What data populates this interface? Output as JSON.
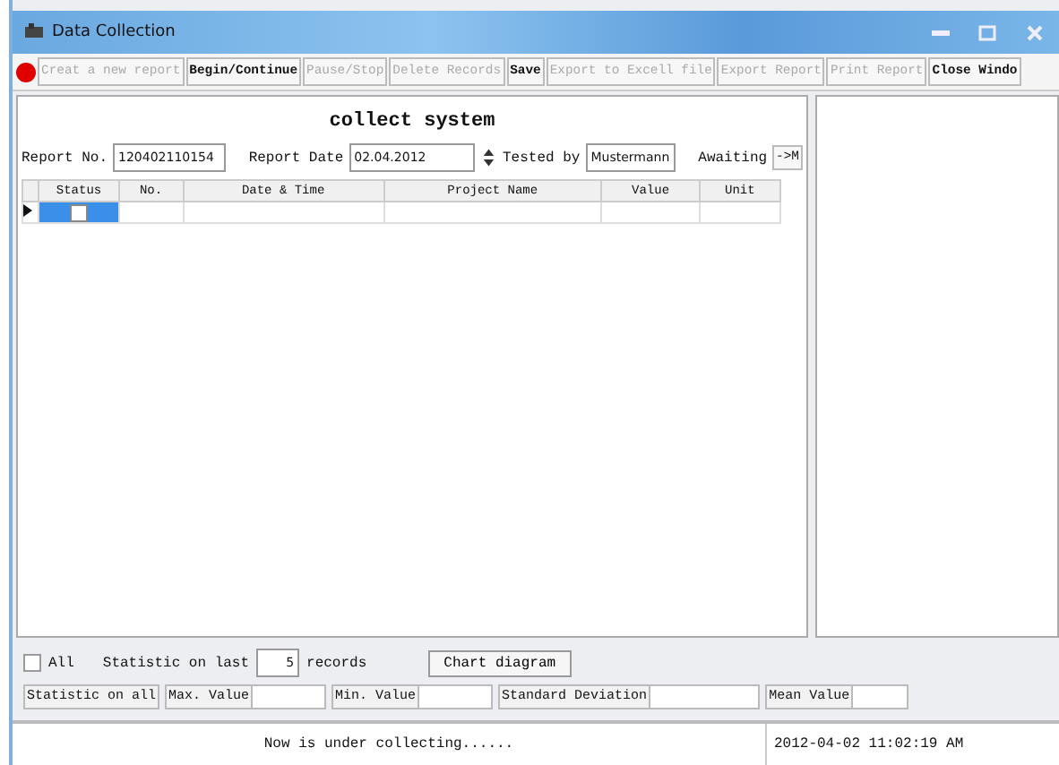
{
  "window": {
    "title": "Data Collection"
  },
  "toolbar": [
    {
      "label": "Creat a new report",
      "disabled": true
    },
    {
      "label": "Begin/Continue",
      "disabled": false
    },
    {
      "label": "Pause/Stop",
      "disabled": true
    },
    {
      "label": "Delete Records",
      "disabled": true
    },
    {
      "label": "Save",
      "disabled": false
    },
    {
      "label": "Export to Excell file",
      "disabled": true
    },
    {
      "label": "Export Report",
      "disabled": true
    },
    {
      "label": "Print Report",
      "disabled": true
    },
    {
      "label": "Close Windo",
      "disabled": false
    }
  ],
  "heading": "collect system",
  "form": {
    "report_no_label": "Report No.",
    "report_no": "120402110154",
    "report_date_label": "Report Date",
    "report_date": "02.04.2012",
    "tested_by_label": "Tested by",
    "tested_by": "Mustermann",
    "awaiting_label": "Awaiting",
    "awaiting_button": "->M"
  },
  "table": {
    "columns": [
      "Status",
      "No.",
      "Date & Time",
      "Project Name",
      "Value",
      "Unit"
    ],
    "rows": [
      {
        "selected": true,
        "checked": false
      }
    ]
  },
  "stats": {
    "all_label": "All",
    "all_checked": false,
    "last_label": "Statistic on last",
    "last_count": "5",
    "records_label": "records",
    "chart_button": "Chart diagram",
    "fields": [
      {
        "label": "Statistic on all",
        "kind": "label"
      },
      {
        "label": "Max. Value",
        "kind": "field"
      },
      {
        "label": "Min. Value",
        "kind": "field"
      },
      {
        "label": "Standard Deviation",
        "kind": "field"
      },
      {
        "label": "Mean Value",
        "kind": "field"
      }
    ]
  },
  "status_bar": {
    "message": "Now is under collecting......",
    "time": "2012-04-02 11:02:19 AM"
  }
}
